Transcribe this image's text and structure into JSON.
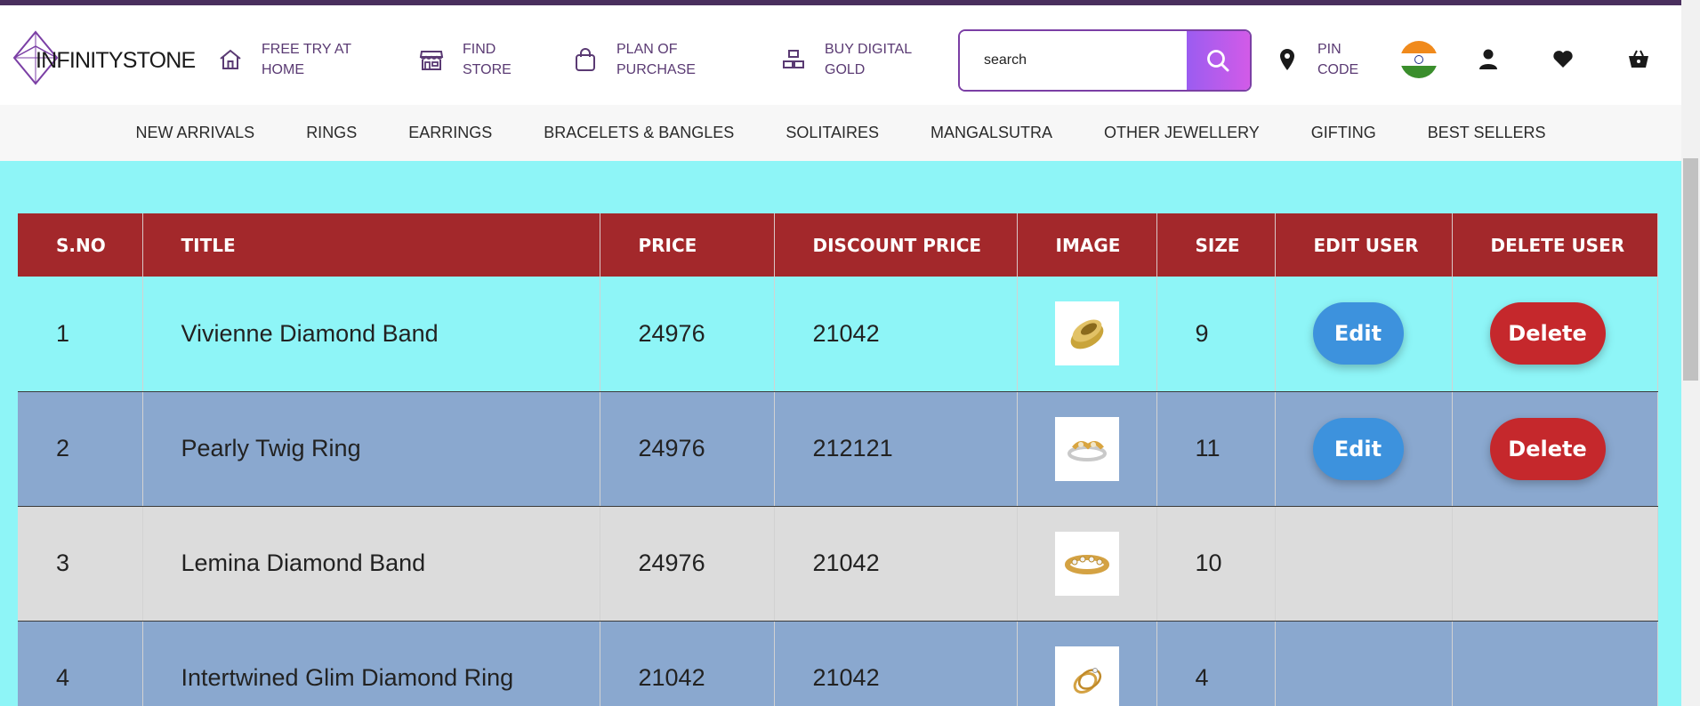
{
  "brand": {
    "logo_text": "INFINITYSTONE",
    "colors": {
      "accent": "#7b3fa5",
      "header_bar": "#4a2f5e",
      "table_header": "#a3282b",
      "edit": "#3d92dd",
      "delete": "#c5282c",
      "page_bg": "#8ef5f7"
    }
  },
  "header": {
    "items": [
      {
        "icon": "home-icon",
        "line1": "FREE TRY AT",
        "line2": "HOME"
      },
      {
        "icon": "store-icon",
        "line1": "FIND",
        "line2": "STORE"
      },
      {
        "icon": "shopping-bag-icon",
        "line1": "PLAN OF",
        "line2": "PURCHASE"
      },
      {
        "icon": "gold-bars-icon",
        "line1": "BUY DIGITAL",
        "line2": "GOLD"
      }
    ],
    "search": {
      "placeholder": "search",
      "value": "search"
    },
    "pin": {
      "line1": "PIN",
      "line2": "CODE"
    }
  },
  "nav": [
    "NEW ARRIVALS",
    "RINGS",
    "EARRINGS",
    "BRACELETS & BANGLES",
    "SOLITAIRES",
    "MANGALSUTRA",
    "OTHER JEWELLERY",
    "GIFTING",
    "BEST SELLERS"
  ],
  "table": {
    "headers": [
      "S.NO",
      "TITLE",
      "PRICE",
      "DISCOUNT PRICE",
      "IMAGE",
      "SIZE",
      "EDIT USER",
      "DELETE USER"
    ],
    "edit_label": "Edit",
    "delete_label": "Delete",
    "rows": [
      {
        "sno": "1",
        "title": "Vivienne Diamond Band",
        "price": "24976",
        "discount": "21042",
        "size": "9",
        "image": "gold-band-ring"
      },
      {
        "sno": "2",
        "title": "Pearly Twig Ring",
        "price": "24976",
        "discount": "212121",
        "size": "11",
        "image": "twig-ring"
      },
      {
        "sno": "3",
        "title": "Lemina Diamond Band",
        "price": "24976",
        "discount": "21042",
        "size": "10",
        "image": "diamond-band"
      },
      {
        "sno": "4",
        "title": "Intertwined Glim Diamond Ring",
        "price": "21042",
        "discount": "21042",
        "size": "4",
        "image": "intertwined-ring"
      }
    ]
  }
}
